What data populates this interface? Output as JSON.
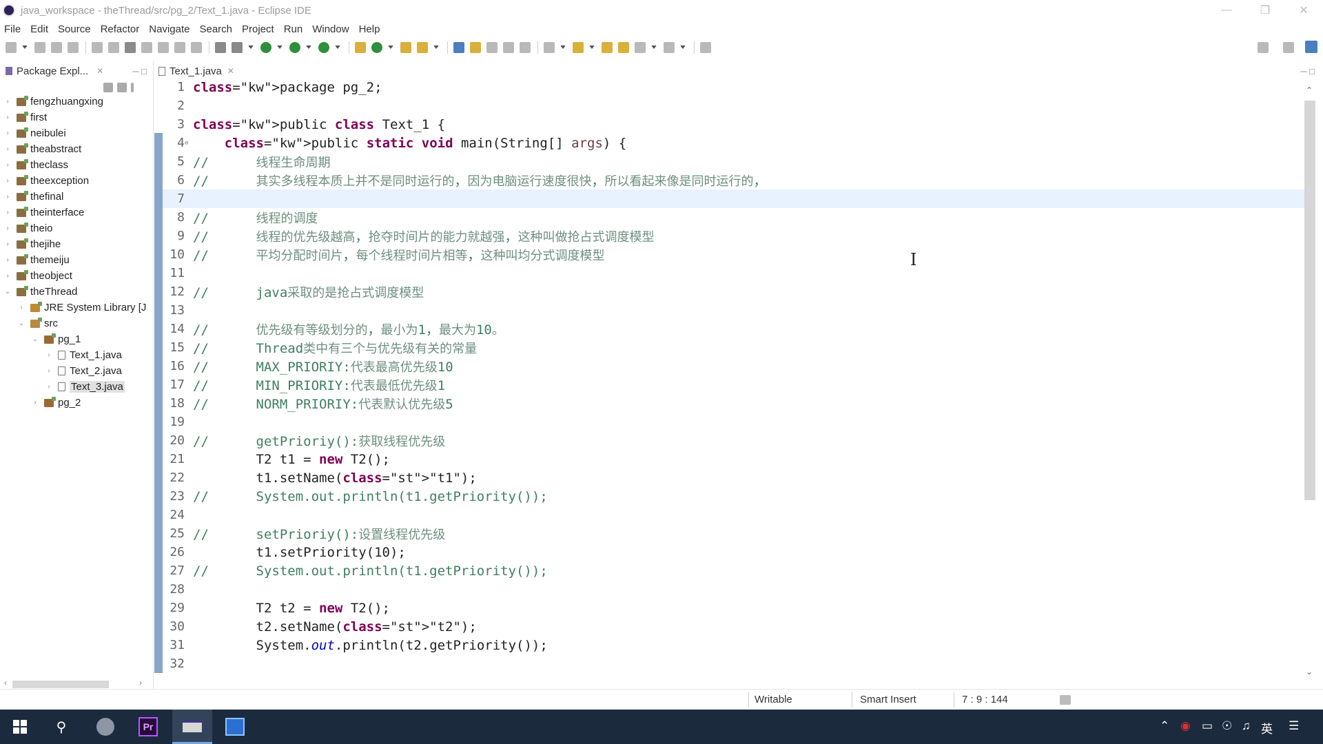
{
  "window": {
    "title": "java_workspace - theThread/src/pg_2/Text_1.java - Eclipse IDE"
  },
  "menu": [
    "File",
    "Edit",
    "Source",
    "Refactor",
    "Navigate",
    "Search",
    "Project",
    "Run",
    "Window",
    "Help"
  ],
  "package_explorer": {
    "tab_label": "Package Expl...",
    "items": [
      {
        "label": "fengzhuangxing",
        "kind": "project"
      },
      {
        "label": "first",
        "kind": "project"
      },
      {
        "label": "neibulei",
        "kind": "project"
      },
      {
        "label": "theabstract",
        "kind": "project"
      },
      {
        "label": "theclass",
        "kind": "project"
      },
      {
        "label": "theexception",
        "kind": "project"
      },
      {
        "label": "thefinal",
        "kind": "project"
      },
      {
        "label": "theinterface",
        "kind": "project"
      },
      {
        "label": "theio",
        "kind": "project"
      },
      {
        "label": "thejihe",
        "kind": "project"
      },
      {
        "label": "themeiju",
        "kind": "project"
      },
      {
        "label": "theobject",
        "kind": "project"
      },
      {
        "label": "theThread",
        "kind": "project",
        "expanded": true
      },
      {
        "label": "JRE System Library [J",
        "kind": "jre"
      },
      {
        "label": "src",
        "kind": "src",
        "expanded": true
      },
      {
        "label": "pg_1",
        "kind": "package",
        "expanded": true
      },
      {
        "label": "Text_1.java",
        "kind": "file"
      },
      {
        "label": "Text_2.java",
        "kind": "file"
      },
      {
        "label": "Text_3.java",
        "kind": "file",
        "selected": true
      },
      {
        "label": "pg_2",
        "kind": "package"
      }
    ]
  },
  "editor": {
    "tab_label": "Text_1.java",
    "current_line": 7,
    "lines": [
      {
        "n": "1",
        "t": "package pg_2;"
      },
      {
        "n": "2",
        "t": ""
      },
      {
        "n": "3",
        "t": "public class Text_1 {"
      },
      {
        "n": "4",
        "t": "    public static void main(String[] args) {"
      },
      {
        "n": "5",
        "t": "//      线程生命周期"
      },
      {
        "n": "6",
        "t": "//      其实多线程本质上并不是同时运行的，因为电脑运行速度很快，所以看起来像是同时运行的，"
      },
      {
        "n": "7",
        "t": ""
      },
      {
        "n": "8",
        "t": "//      线程的调度"
      },
      {
        "n": "9",
        "t": "//      线程的优先级越高，抢夺时间片的能力就越强，这种叫做抢占式调度模型"
      },
      {
        "n": "10",
        "t": "//      平均分配时间片，每个线程时间片相等，这种叫均分式调度模型"
      },
      {
        "n": "11",
        "t": ""
      },
      {
        "n": "12",
        "t": "//      java采取的是抢占式调度模型"
      },
      {
        "n": "13",
        "t": ""
      },
      {
        "n": "14",
        "t": "//      优先级有等级划分的，最小为1，最大为10。"
      },
      {
        "n": "15",
        "t": "//      Thread类中有三个与优先级有关的常量"
      },
      {
        "n": "16",
        "t": "//      MAX_PRIORIY:代表最高优先级10"
      },
      {
        "n": "17",
        "t": "//      MIN_PRIORIY:代表最低优先级1"
      },
      {
        "n": "18",
        "t": "//      NORM_PRIORIY:代表默认优先级5"
      },
      {
        "n": "19",
        "t": ""
      },
      {
        "n": "20",
        "t": "//      getPrioriy():获取线程优先级"
      },
      {
        "n": "21",
        "t": "        T2 t1 = new T2();"
      },
      {
        "n": "22",
        "t": "        t1.setName(\"t1\");"
      },
      {
        "n": "23",
        "t": "//      System.out.println(t1.getPriority());"
      },
      {
        "n": "24",
        "t": ""
      },
      {
        "n": "25",
        "t": "//      setPrioriy():设置线程优先级"
      },
      {
        "n": "26",
        "t": "        t1.setPriority(10);"
      },
      {
        "n": "27",
        "t": "//      System.out.println(t1.getPriority());"
      },
      {
        "n": "28",
        "t": ""
      },
      {
        "n": "29",
        "t": "        T2 t2 = new T2();"
      },
      {
        "n": "30",
        "t": "        t2.setName(\"t2\");"
      },
      {
        "n": "31",
        "t": "        System.out.println(t2.getPriority());"
      },
      {
        "n": "32",
        "t": ""
      }
    ]
  },
  "status": {
    "writable": "Writable",
    "insert_mode": "Smart Insert",
    "position": "7 : 9 : 144"
  },
  "taskbar": {
    "ime_label": "英",
    "app2_label": "Pr"
  },
  "colors": {
    "keyword": "#7f0055",
    "comment": "#3f7f5f",
    "string": "#2a00ff",
    "field": "#0000c0",
    "current_line": "#e8f2fe",
    "taskbar": "#1c2a3d"
  }
}
